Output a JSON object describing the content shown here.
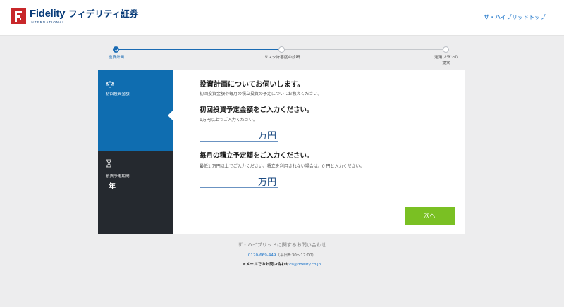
{
  "header": {
    "brand": "Fidelity",
    "brand_jp": "フィデリティ証券",
    "brand_sub": "INTERNATIONAL",
    "top_link": "ザ・ハイブリッドトップ"
  },
  "progress": {
    "steps": [
      {
        "label": "投資計画",
        "state": "done"
      },
      {
        "label": "リスク許容度の診断",
        "state": "pending"
      },
      {
        "label": "運用プランの\n提案",
        "state": "pending"
      }
    ]
  },
  "sidebar": {
    "items": [
      {
        "icon": "scale-icon",
        "label": "初回投資金額",
        "value": ""
      },
      {
        "icon": "hourglass-icon",
        "label": "投資予定期間",
        "value": "年"
      }
    ]
  },
  "form": {
    "heading": "投資計画についてお伺いします。",
    "intro": "初回投資金額や毎月の積立投資の予定についてお教えください。",
    "initial": {
      "heading": "初回投資予定金額をご入力ください。",
      "hint": "1万円以上でご入力ください。",
      "value": "",
      "unit": "万円"
    },
    "monthly": {
      "heading": "毎月の積立予定額をご入力ください。",
      "hint": "最低1 万円以上でご入力ください。積立を利用されない場合は、0 円と入力ください。",
      "value": "",
      "unit": "万円"
    },
    "next_label": "次へ"
  },
  "footer": {
    "contact_title": "ザ・ハイブリッドに関するお問い合わせ",
    "phone": "0120-669-449",
    "hours": "（平日8:30〜17:00）",
    "email_label": "Eメールでのお問い合わせ",
    "email": "cs@fidelity.co.jp"
  },
  "colors": {
    "accent_blue": "#0f6db0",
    "dark_panel": "#25292f",
    "next_green": "#7ac023",
    "link_blue": "#1a73c9",
    "brand_red": "#c8272a"
  }
}
